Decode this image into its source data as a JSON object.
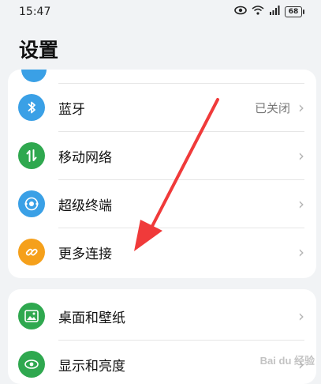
{
  "status_bar": {
    "time": "15:47",
    "battery": "68",
    "icons": [
      "eye-icon",
      "wifi-icon",
      "signal-icon",
      "battery-icon"
    ]
  },
  "page": {
    "title": "设置"
  },
  "card1": {
    "items": [
      {
        "label": "蓝牙",
        "value": "已关闭",
        "icon": "bluetooth-icon",
        "color": "#3aa0e6"
      },
      {
        "label": "移动网络",
        "value": "",
        "icon": "mobile-data-icon",
        "color": "#2fa84f"
      },
      {
        "label": "超级终端",
        "value": "",
        "icon": "super-device-icon",
        "color": "#3aa0e6"
      },
      {
        "label": "更多连接",
        "value": "",
        "icon": "link-icon",
        "color": "#f5a01b"
      }
    ]
  },
  "card2": {
    "items": [
      {
        "label": "桌面和壁纸",
        "value": "",
        "icon": "wallpaper-icon",
        "color": "#2fa84f"
      },
      {
        "label": "显示和亮度",
        "value": "",
        "icon": "display-icon",
        "color": "#2fa84f"
      }
    ]
  },
  "overlay": {
    "arrow_color": "#f03a3a",
    "watermark": "Bai du 经验"
  }
}
